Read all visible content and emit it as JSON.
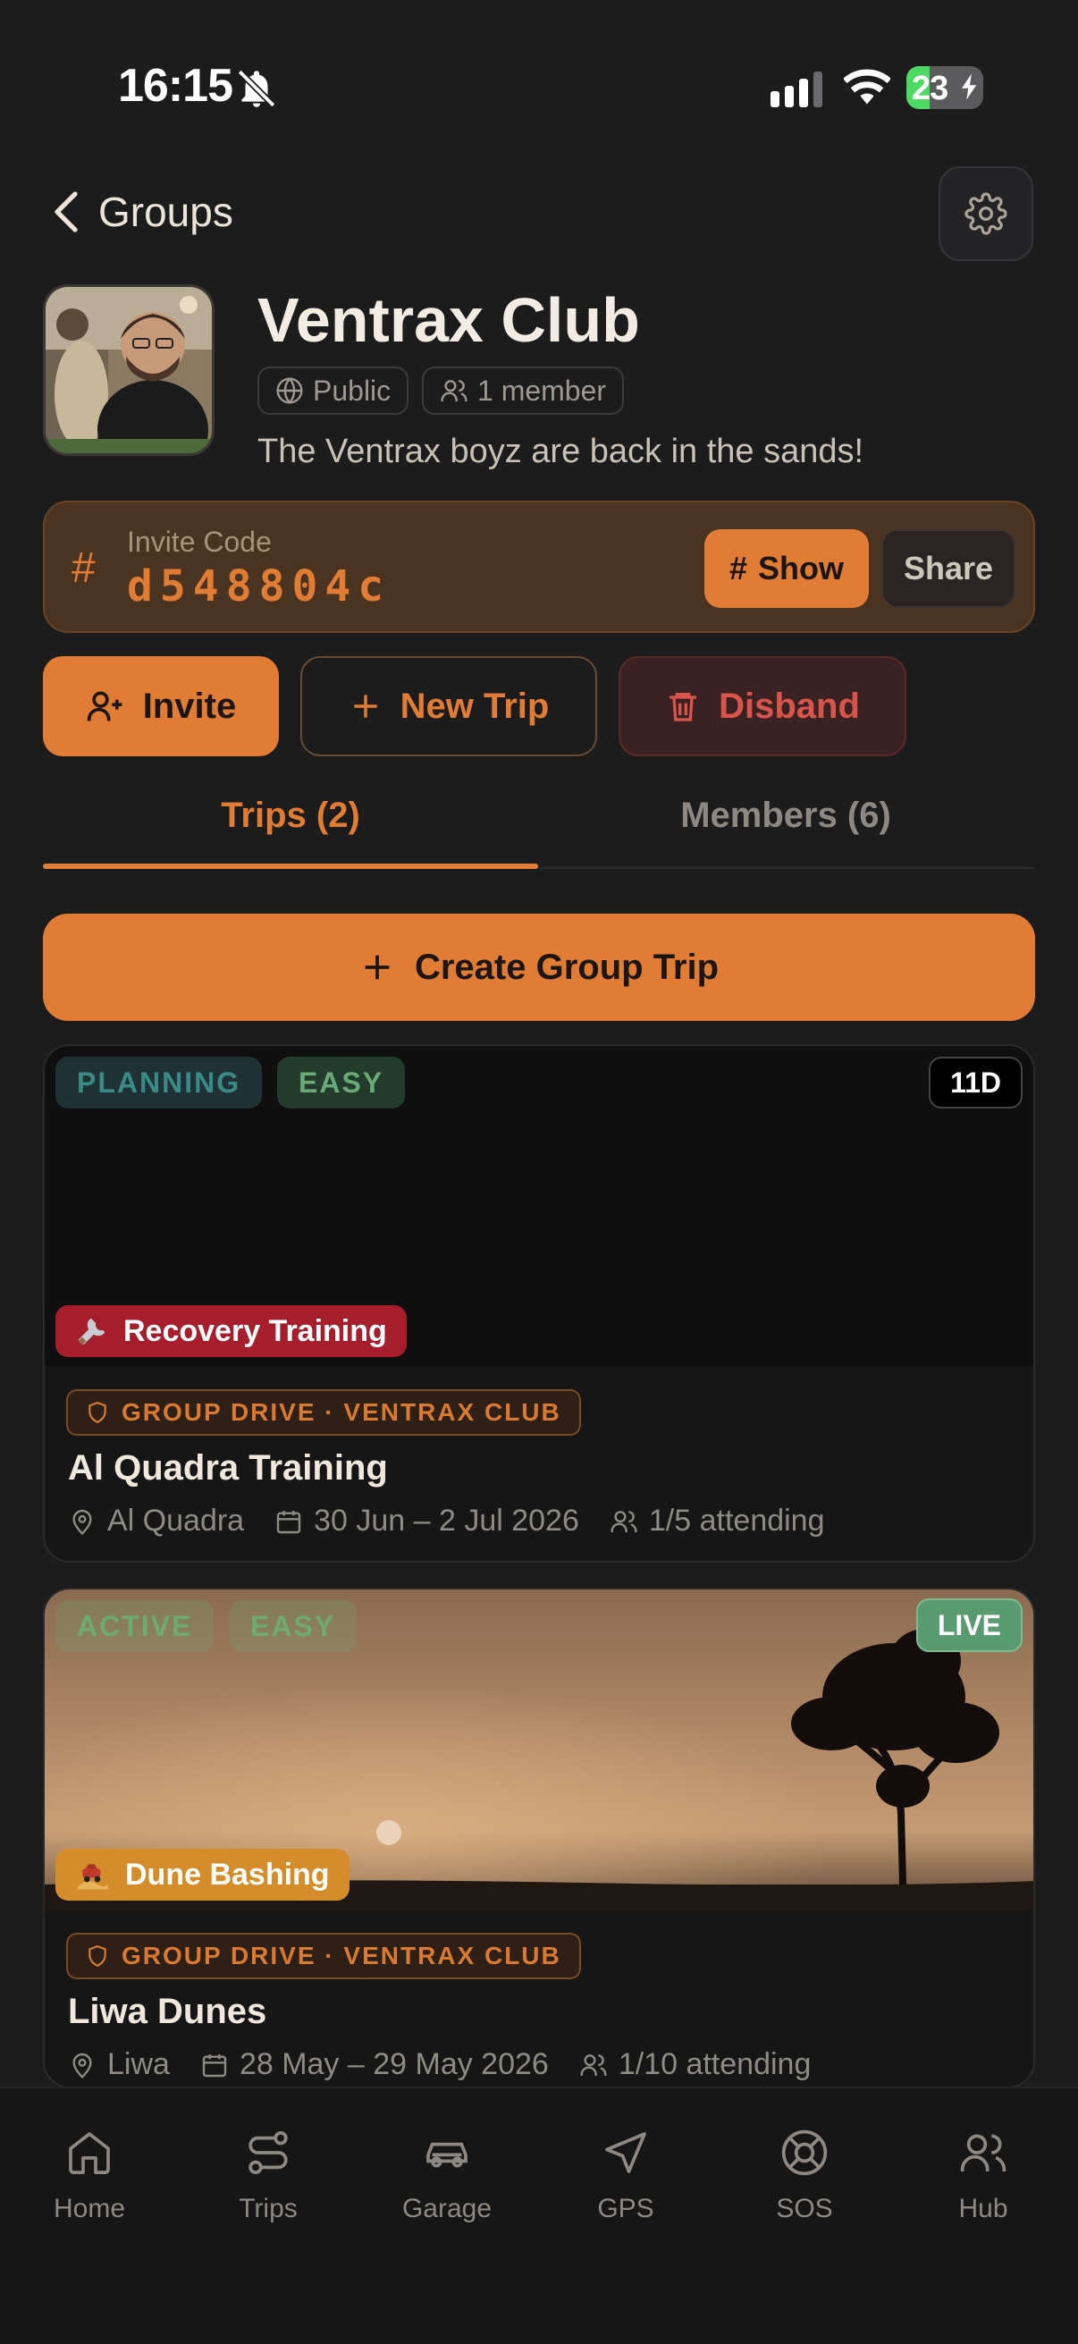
{
  "status_bar": {
    "time": "16:15",
    "battery": "23"
  },
  "header": {
    "back_label": "Groups"
  },
  "group": {
    "name": "Ventrax Club",
    "visibility": "Public",
    "members_chip": "1 member",
    "description": "The Ventrax boyz are back in the sands!"
  },
  "invite": {
    "label": "Invite Code",
    "code": "d548804c",
    "show_label": "Show",
    "share_label": "Share"
  },
  "actions": {
    "invite_label": "Invite",
    "new_trip_label": "New Trip",
    "disband_label": "Disband"
  },
  "tabs": [
    {
      "label": "Trips (2)",
      "active": true
    },
    {
      "label": "Members (6)",
      "active": false
    }
  ],
  "create_trip_label": "Create Group Trip",
  "trips": [
    {
      "status": "PLANNING",
      "difficulty": "EASY",
      "countdown": "11D",
      "category": "Recovery Training",
      "category_icon": "wrench-icon",
      "tag": "GROUP DRIVE · VENTRAX CLUB",
      "title": "Al Quadra Training",
      "location": "Al Quadra",
      "dates": "30 Jun – 2 Jul 2026",
      "attending": "1/5 attending"
    },
    {
      "status": "ACTIVE",
      "difficulty": "EASY",
      "countdown": "LIVE",
      "category": "Dune Bashing",
      "category_icon": "desert-car-icon",
      "tag": "GROUP DRIVE · VENTRAX CLUB",
      "title": "Liwa Dunes",
      "location": "Liwa",
      "dates": "28 May – 29 May 2026",
      "attending": "1/10 attending"
    }
  ],
  "nav": [
    {
      "label": "Home",
      "icon": "home-icon"
    },
    {
      "label": "Trips",
      "icon": "route-icon"
    },
    {
      "label": "Garage",
      "icon": "car-icon"
    },
    {
      "label": "GPS",
      "icon": "navigation-icon"
    },
    {
      "label": "SOS",
      "icon": "lifebuoy-icon"
    },
    {
      "label": "Hub",
      "icon": "users-icon"
    }
  ],
  "colors": {
    "accent": "#e07c33",
    "background": "#1c1c1d",
    "danger": "#d9544a",
    "live": "#5a9a70"
  }
}
